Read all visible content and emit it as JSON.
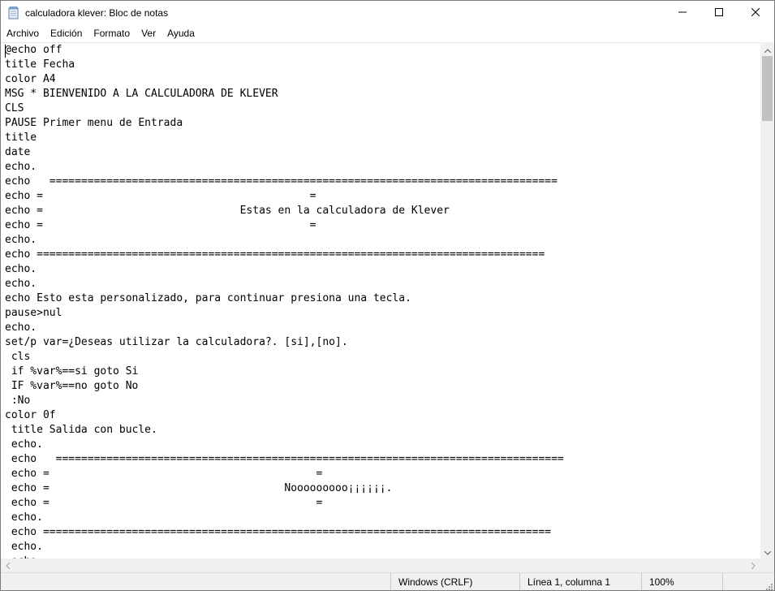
{
  "window": {
    "title": "calculadora klever: Bloc de notas",
    "icon": "notepad-icon"
  },
  "window_controls": {
    "minimize_icon": "minimize-icon",
    "maximize_icon": "maximize-icon",
    "close_icon": "close-icon"
  },
  "menu": {
    "items": [
      {
        "label": "Archivo"
      },
      {
        "label": "Edición"
      },
      {
        "label": "Formato"
      },
      {
        "label": "Ver"
      },
      {
        "label": "Ayuda"
      }
    ]
  },
  "editor": {
    "lines": [
      "@echo off",
      "title Fecha",
      "color A4",
      "MSG * BIENVENIDO A LA CALCULADORA DE KLEVER",
      "CLS",
      "PAUSE Primer menu de Entrada",
      "title",
      "date",
      "echo.",
      "echo   ================================================================================",
      "echo =                                          =",
      "echo =                               Estas en la calculadora de Klever",
      "echo =                                          =",
      "echo.",
      "echo ================================================================================",
      "echo.",
      "echo.",
      "echo Esto esta personalizado, para continuar presiona una tecla.",
      "pause>nul",
      "echo.",
      "set/p var=¿Deseas utilizar la calculadora?. [si],[no].",
      " cls",
      " if %var%==si goto Si",
      " IF %var%==no goto No",
      " :No",
      "color 0f",
      " title Salida con bucle.",
      " echo.",
      " echo   ================================================================================",
      " echo =                                          =",
      " echo =                                     Nooooooooo¡¡¡¡¡¡.",
      " echo =                                          =",
      " echo.",
      " echo ================================================================================",
      " echo.",
      " echo."
    ]
  },
  "statusbar": {
    "line_ending": "Windows (CRLF)",
    "position": "Línea 1, columna 1",
    "zoom": "100%"
  }
}
